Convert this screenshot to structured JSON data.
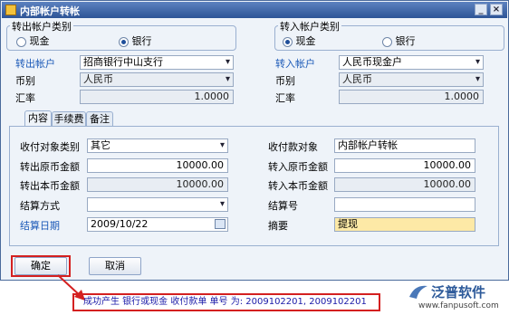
{
  "window": {
    "title": "内部帐户转帐",
    "min_label": "_",
    "close_label": "×"
  },
  "out_type": {
    "legend": "转出帐户类别",
    "options": [
      {
        "label": "现金",
        "selected": false
      },
      {
        "label": "银行",
        "selected": true
      }
    ]
  },
  "in_type": {
    "legend": "转入帐户类别",
    "options": [
      {
        "label": "现金",
        "selected": true
      },
      {
        "label": "银行",
        "selected": false
      }
    ]
  },
  "out_account": {
    "label": "转出帐户",
    "value": "招商银行中山支行",
    "currency_label": "币别",
    "currency": "人民币",
    "rate_label": "汇率",
    "rate": "1.0000"
  },
  "in_account": {
    "label": "转入帐户",
    "value": "人民币现金户",
    "currency_label": "币别",
    "currency": "人民币",
    "rate_label": "汇率",
    "rate": "1.0000"
  },
  "tabs": [
    {
      "label": "内容",
      "active": true
    },
    {
      "label": "手续费",
      "active": false
    },
    {
      "label": "备注",
      "active": false
    }
  ],
  "form": {
    "payee_type_label": "收付对象类别",
    "payee_type": "其它",
    "out_amount_label": "转出原币金额",
    "out_amount": "10000.00",
    "out_local_label": "转出本币金额",
    "out_local": "10000.00",
    "settle_method_label": "结算方式",
    "settle_method": "",
    "settle_date_label": "结算日期",
    "settle_date": "2009/10/22",
    "payee_label": "收付款对象",
    "payee": "内部帐户转帐",
    "in_amount_label": "转入原币金额",
    "in_amount": "10000.00",
    "in_local_label": "转入本币金额",
    "in_local": "10000.00",
    "settle_no_label": "结算号",
    "settle_no": "",
    "summary_label": "摘要",
    "summary": "提现"
  },
  "buttons": {
    "ok": "确定",
    "cancel": "取消"
  },
  "status": "成功产生 银行或现金 收付款单 单号 为: 2009102201, 2009102201",
  "watermark": {
    "brand": "泛普软件",
    "url": "www.fanpusoft.com"
  },
  "colors": {
    "accent": "#1c5ab8",
    "highlight": "#fde9a6",
    "alert": "#d42020"
  }
}
